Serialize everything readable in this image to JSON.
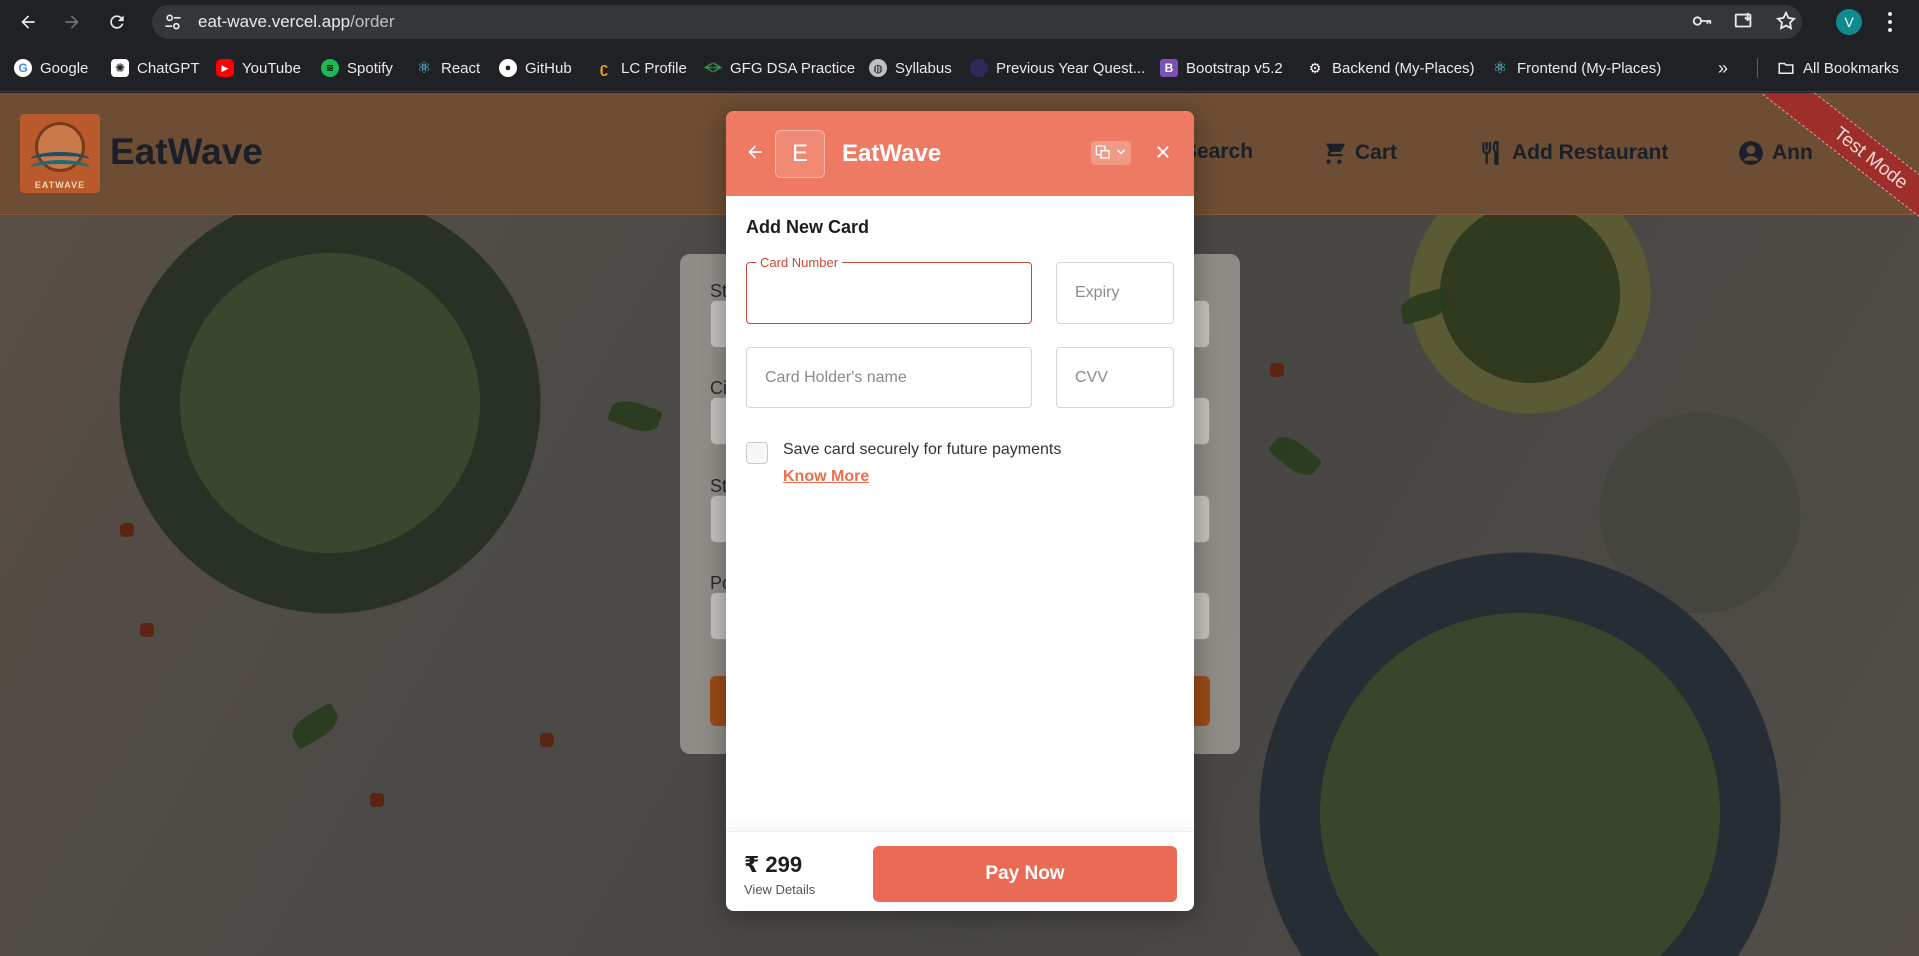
{
  "browser": {
    "url_host": "eat-wave.vercel.app",
    "url_path": "/order",
    "profile_initial": "V",
    "bookmarks": [
      {
        "label": "Google",
        "icon": "google-icon",
        "color": "#ffffff"
      },
      {
        "label": "ChatGPT",
        "icon": "chatgpt-icon",
        "color": "#ffffff"
      },
      {
        "label": "YouTube",
        "icon": "youtube-icon",
        "color": "#ff0000"
      },
      {
        "label": "Spotify",
        "icon": "spotify-icon",
        "color": "#1db954"
      },
      {
        "label": "React",
        "icon": "react-icon",
        "color": "#61dafb"
      },
      {
        "label": "GitHub",
        "icon": "github-icon",
        "color": "#ffffff"
      },
      {
        "label": "LC Profile",
        "icon": "leetcode-icon",
        "color": "#ffa116"
      },
      {
        "label": "GFG DSA Practice",
        "icon": "gfg-icon",
        "color": "#2f8d46"
      },
      {
        "label": "Syllabus",
        "icon": "globe-icon",
        "color": "#bdc1c6"
      },
      {
        "label": "Previous Year Quest...",
        "icon": "page-icon",
        "color": "#3c3c8a"
      },
      {
        "label": "Bootstrap v5.2",
        "icon": "bootstrap-icon",
        "color": "#7952b3"
      },
      {
        "label": "Backend (My-Places)",
        "icon": "backend-icon",
        "color": "#ffffff"
      },
      {
        "label": "Frontend (My-Places)",
        "icon": "react-icon",
        "color": "#61dafb"
      }
    ],
    "all_bookmarks_label": "All Bookmarks"
  },
  "site": {
    "brand": "EatWave",
    "logo_text": "EATWAVE",
    "nav": {
      "search": "Search",
      "cart": "Cart",
      "add_restaurant": "Add Restaurant",
      "account": "Ann"
    },
    "ribbon": "Test Mode"
  },
  "modal": {
    "logo_letter": "E",
    "title": "EatWave",
    "heading": "Add New Card",
    "card_number_label": "Card Number",
    "expiry_placeholder": "Expiry",
    "holder_placeholder": "Card Holder's name",
    "cvv_placeholder": "CVV",
    "save_card_text": "Save card securely for future payments",
    "know_more": "Know More",
    "amount": "₹ 299",
    "view_details": "View Details",
    "pay_now": "Pay Now"
  },
  "colors": {
    "header_accent": "#ee7a64",
    "pay_button": "#ea6b55",
    "active_border": "#c04a3a",
    "ribbon": "#9d2e2a"
  }
}
